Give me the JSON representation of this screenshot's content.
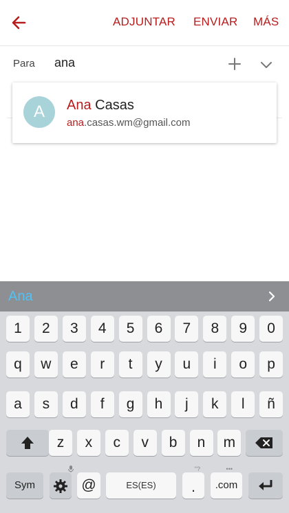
{
  "appbar": {
    "back_icon": "arrow-left-icon",
    "actions": {
      "attach": "ADJUNTAR",
      "send": "ENVIAR",
      "more": "MÁS"
    },
    "accent": "#b71c1c"
  },
  "compose": {
    "to_label": "Para",
    "to_value": "ana"
  },
  "suggestion": {
    "avatar_letter": "A",
    "avatar_color": "#a8d3d9",
    "name_match": "Ana",
    "name_rest": " Casas",
    "email_match": "ana",
    "email_rest": ".casas.wm@gmail.com"
  },
  "keyboard": {
    "prediction": "Ana",
    "number_row": [
      "1",
      "2",
      "3",
      "4",
      "5",
      "6",
      "7",
      "8",
      "9",
      "0"
    ],
    "row1": [
      "q",
      "w",
      "e",
      "r",
      "t",
      "y",
      "u",
      "i",
      "o",
      "p"
    ],
    "row2": [
      "a",
      "s",
      "d",
      "f",
      "g",
      "h",
      "j",
      "k",
      "l",
      "ñ"
    ],
    "row3": [
      "z",
      "x",
      "c",
      "v",
      "b",
      "n",
      "m"
    ],
    "sym_label": "Sym",
    "at_label": "@",
    "space_label": "ES(ES)",
    "period_label": ".",
    "period_hint": "\"?",
    "dotcom_label": ".com",
    "dotcom_hint": "•••"
  }
}
